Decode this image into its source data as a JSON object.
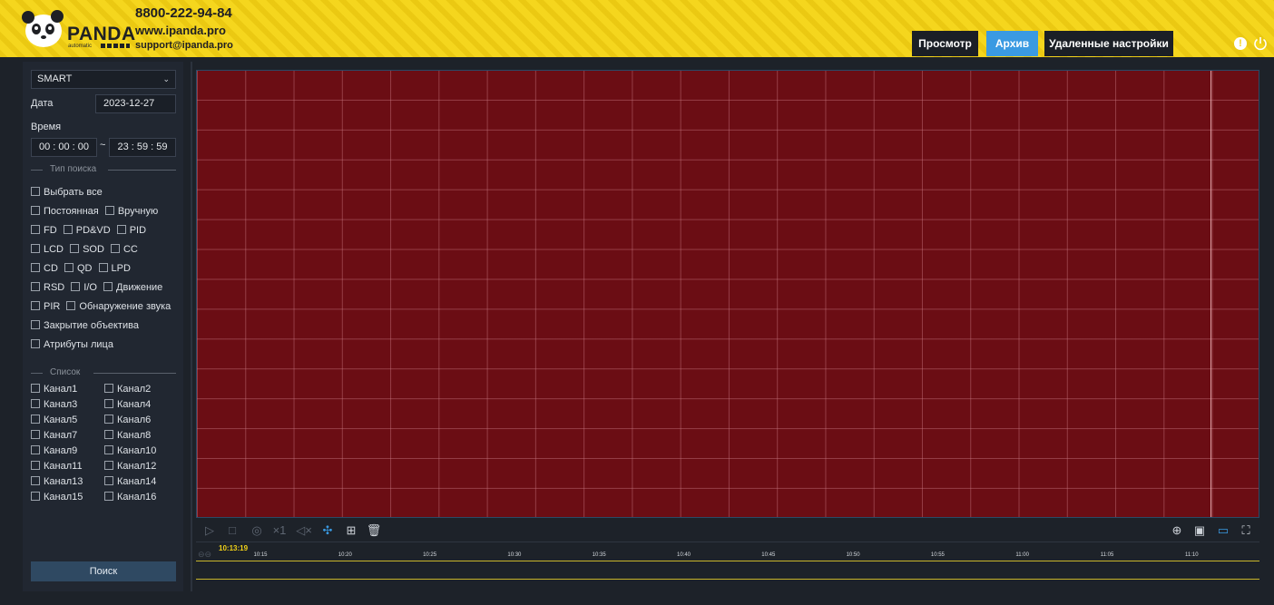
{
  "header": {
    "brand": "PANDA",
    "brand_sub": "automatic",
    "phone": "8800-222-94-84",
    "site": "www.ipanda.pro",
    "mail": "support@ipanda.pro",
    "nav": [
      {
        "label": "Просмотр",
        "active": false
      },
      {
        "label": "Архив",
        "active": true
      },
      {
        "label": "Удаленные настройки",
        "active": false
      }
    ],
    "alert_glyph": "!"
  },
  "sidebar": {
    "mode_select": "SMART",
    "date_label": "Дата",
    "date_value": "2023-12-27",
    "time_label": "Время",
    "time_from": "00  :  00  :  00",
    "time_to": "23  :  59  :  59",
    "tilde": "~",
    "search_type_title": "Тип поиска",
    "list_title": "Список",
    "search_button": "Поиск",
    "filters": {
      "select_all": "Выбрать все",
      "row1": [
        "Постоянная",
        "Вручную"
      ],
      "row2": [
        "FD",
        "PD&VD",
        "PID"
      ],
      "row3": [
        "LCD",
        "SOD",
        "CC"
      ],
      "row4": [
        "CD",
        "QD",
        "LPD"
      ],
      "row5": [
        "RSD",
        "I/O",
        "Движение"
      ],
      "row6": [
        "PIR",
        "Обнаружение звука"
      ],
      "row7": "Закрытие объектива",
      "row8": "Атрибуты лица"
    },
    "channels_left": [
      "Канал1",
      "Канал3",
      "Канал5",
      "Канал7",
      "Канал9",
      "Канал11",
      "Канал13",
      "Канал15"
    ],
    "channels_right": [
      "Канал2",
      "Канал4",
      "Канал6",
      "Канал8",
      "Канал10",
      "Канал12",
      "Канал14",
      "Канал16"
    ]
  },
  "toolbar": {
    "icons_left": [
      {
        "name": "play-icon",
        "glyph": "▷"
      },
      {
        "name": "stop-icon",
        "glyph": "□"
      },
      {
        "name": "snapshot-icon",
        "glyph": "◎"
      },
      {
        "name": "speed-icon",
        "glyph": "×1"
      },
      {
        "name": "mute-icon",
        "glyph": "◁×"
      },
      {
        "name": "fan-icon",
        "glyph": "✣"
      },
      {
        "name": "clip-icon",
        "glyph": "⊞"
      },
      {
        "name": "delete-icon",
        "glyph": "🗑"
      }
    ],
    "icons_right": [
      {
        "name": "zoom-in-icon",
        "glyph": "⊕"
      },
      {
        "name": "aspect-original-icon",
        "glyph": "▣"
      },
      {
        "name": "aspect-stretch-icon",
        "glyph": "▭"
      },
      {
        "name": "fullscreen-icon",
        "glyph": "⛶"
      }
    ]
  },
  "timeline": {
    "current_time": "10:13:19",
    "ticks": [
      "10:15",
      "10:20",
      "10:25",
      "10:30",
      "10:35",
      "10:40",
      "10:45",
      "10:50",
      "10:55",
      "11:00",
      "11:05",
      "11:10"
    ]
  },
  "colors": {
    "brand_yellow": "#f3d318",
    "accent_blue": "#3a9ae2",
    "video_red": "#6b0d14"
  }
}
